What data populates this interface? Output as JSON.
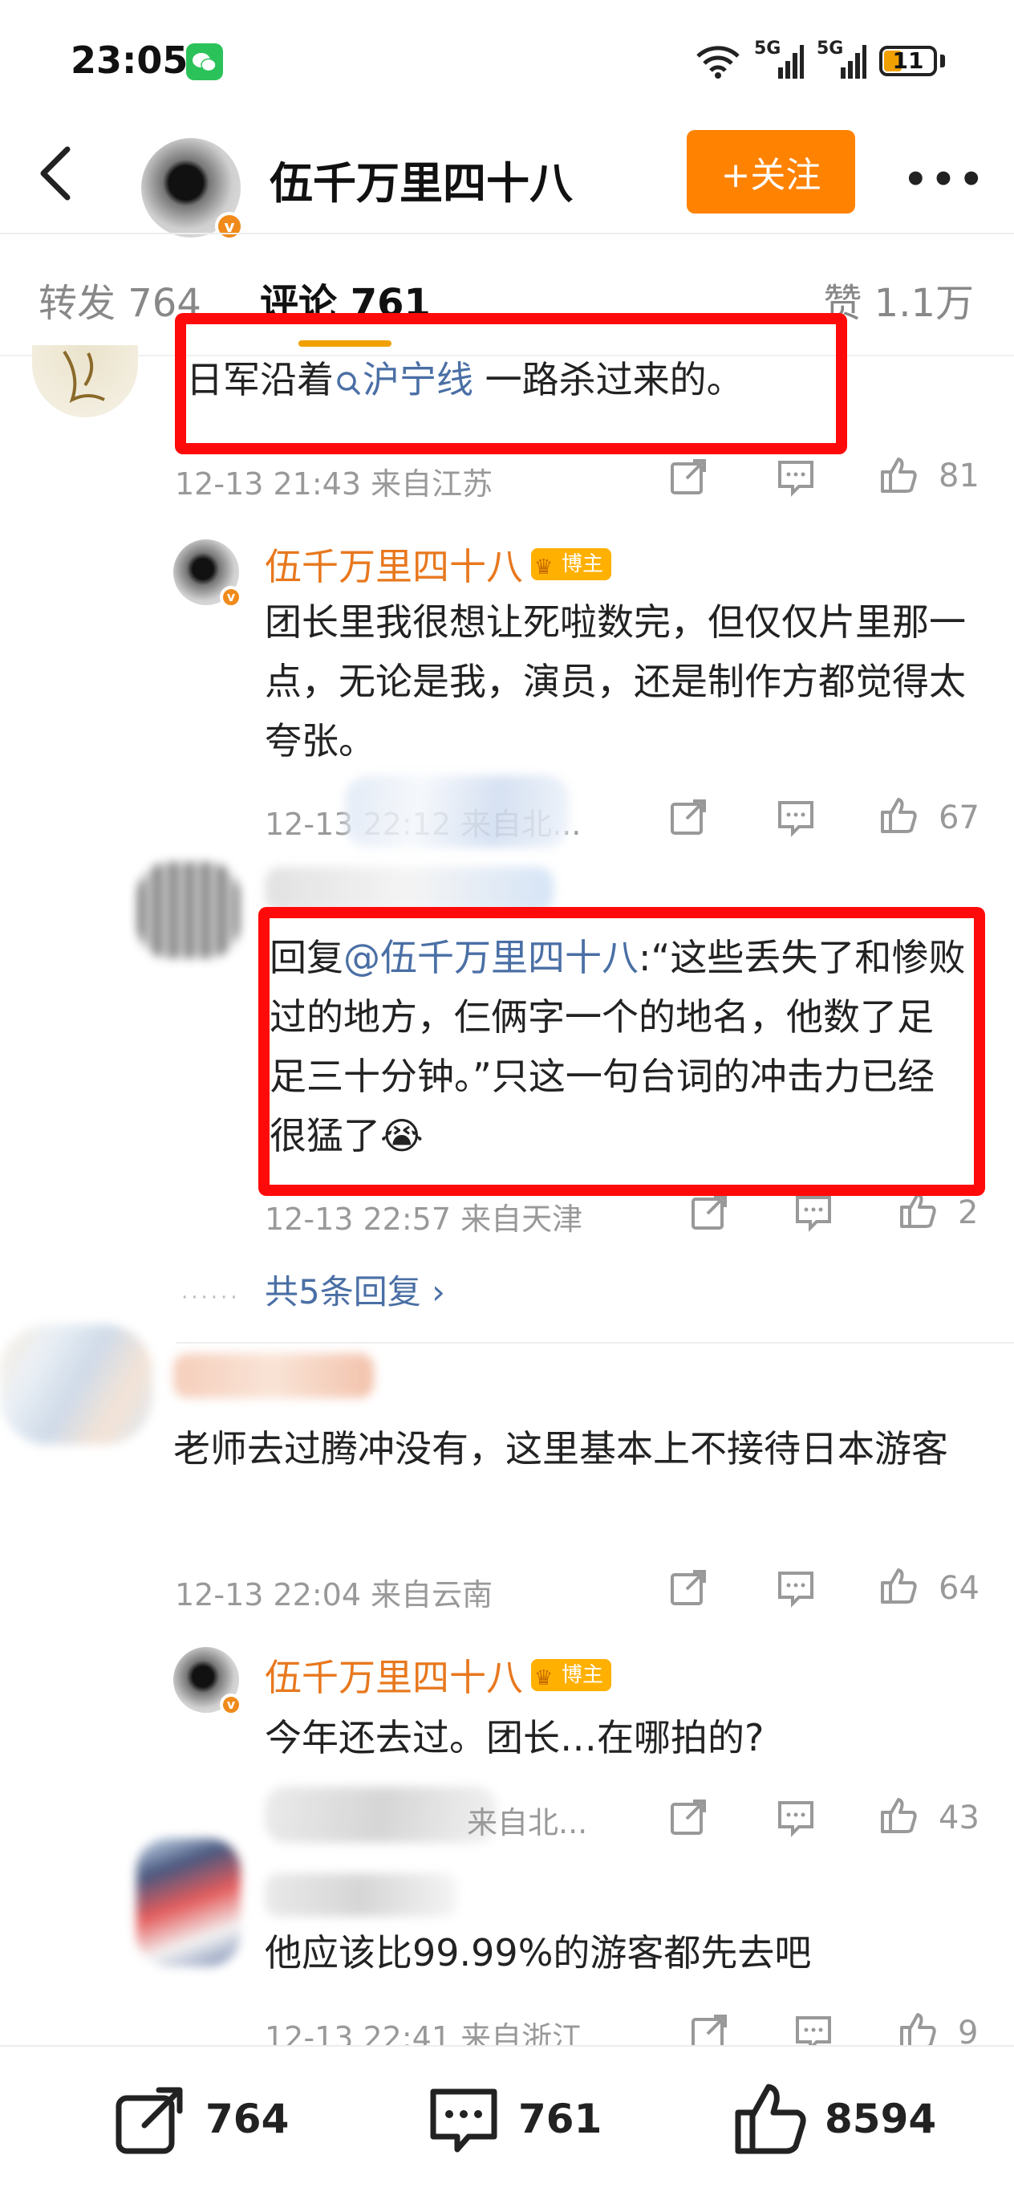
{
  "status_bar": {
    "time": "23:05",
    "network1": "5G",
    "network2": "5G",
    "battery": "11"
  },
  "header": {
    "author": "伍千万里四十八",
    "follow_label": "+关注",
    "more": "•••"
  },
  "tabs": {
    "repost": "转发 764",
    "comments": "评论 761",
    "likes": "赞 1.1万"
  },
  "comments": [
    {
      "text_before": "日军沿着",
      "topic": "沪宁线",
      "text_after": " 一路杀过来的。",
      "time": "12-13 21:43 来自江苏",
      "likes": "81"
    },
    {
      "author": "伍千万里四十八",
      "badge": "博主",
      "text": "团长里我很想让死啦数完，但仅仅片里那一点，无论是我，演员，还是制作方都觉得太夸张。",
      "time": "12-13 22:12 来自北...",
      "likes": "67"
    },
    {
      "reply_prefix": "回复",
      "mention": "@伍千万里四十八",
      "text": ":“这些丢失了和惨败过的地方，仨俩字一个的地名，他数了足足三十分钟。”只这一句台词的冲击力已经很猛了😭",
      "time": "12-13 22:57 来自天津",
      "likes": "2"
    },
    {
      "more_replies": "共5条回复 ›"
    },
    {
      "text": "老师去过腾冲没有，这里基本上不接待日本游客",
      "time": "12-13 22:04 来自云南",
      "likes": "64"
    },
    {
      "author": "伍千万里四十八",
      "badge": "博主",
      "text": "今年还去过。团长…在哪拍的?",
      "time": "来自北...",
      "likes": "43"
    },
    {
      "text": "他应该比99.99%的游客都先去吧",
      "time": "12-13 22:41 来自浙江",
      "likes": "9"
    }
  ],
  "bottom_bar": {
    "repost_count": "764",
    "comment_count": "761",
    "like_count": "8594"
  },
  "colors": {
    "accent": "#ff8200",
    "highlight_box": "#ff0a0a",
    "author_name": "#e8781e",
    "link": "#4a6fa5"
  }
}
